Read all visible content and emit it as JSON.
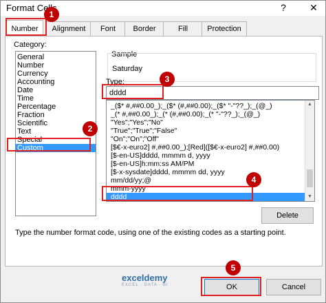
{
  "window": {
    "title": "Format Cells",
    "help_glyph": "?",
    "close_glyph": "✕"
  },
  "tabs": [
    {
      "label": "Number"
    },
    {
      "label": "Alignment"
    },
    {
      "label": "Font"
    },
    {
      "label": "Border"
    },
    {
      "label": "Fill"
    },
    {
      "label": "Protection"
    }
  ],
  "category": {
    "label": "Category:",
    "items": [
      "General",
      "Number",
      "Currency",
      "Accounting",
      "Date",
      "Time",
      "Percentage",
      "Fraction",
      "Scientific",
      "Text",
      "Special",
      "Custom"
    ],
    "selected": "Custom"
  },
  "sample": {
    "label": "Sample",
    "value": "Saturday"
  },
  "type": {
    "label": "Type:",
    "value": "dddd",
    "formats": [
      "_($* #,##0.00_);_($* (#,##0.00);_($* \"-\"??_);_(@_)",
      "_(* #,##0.00_);_(* (#,##0.00);_(* \"-\"??_);_(@_)",
      "\"Yes\";\"Yes\";\"No\"",
      "\"True\";\"True\";\"False\"",
      "\"On\";\"On\";\"Off\"",
      "[$€-x-euro2] #,##0.00_);[Red]([$€-x-euro2] #,##0.00)",
      "[$-en-US]dddd, mmmm d, yyyy",
      "[$-en-US]h:mm:ss AM/PM",
      "[$-x-sysdate]dddd, mmmm dd, yyyy",
      "mm/dd/yy;@",
      "mmm-yyyy",
      "dddd"
    ],
    "selected": "dddd"
  },
  "buttons": {
    "delete": "Delete",
    "ok": "OK",
    "cancel": "Cancel"
  },
  "hint": "Type the number format code, using one of the existing codes as a starting point.",
  "watermark": {
    "name": "exceldemy",
    "sub": "EXCEL · DATA · BI"
  },
  "badges": [
    "1",
    "2",
    "3",
    "4",
    "5"
  ],
  "colors": {
    "annotation": "#e02020",
    "badge": "#c00000",
    "selection": "#3399ff"
  }
}
